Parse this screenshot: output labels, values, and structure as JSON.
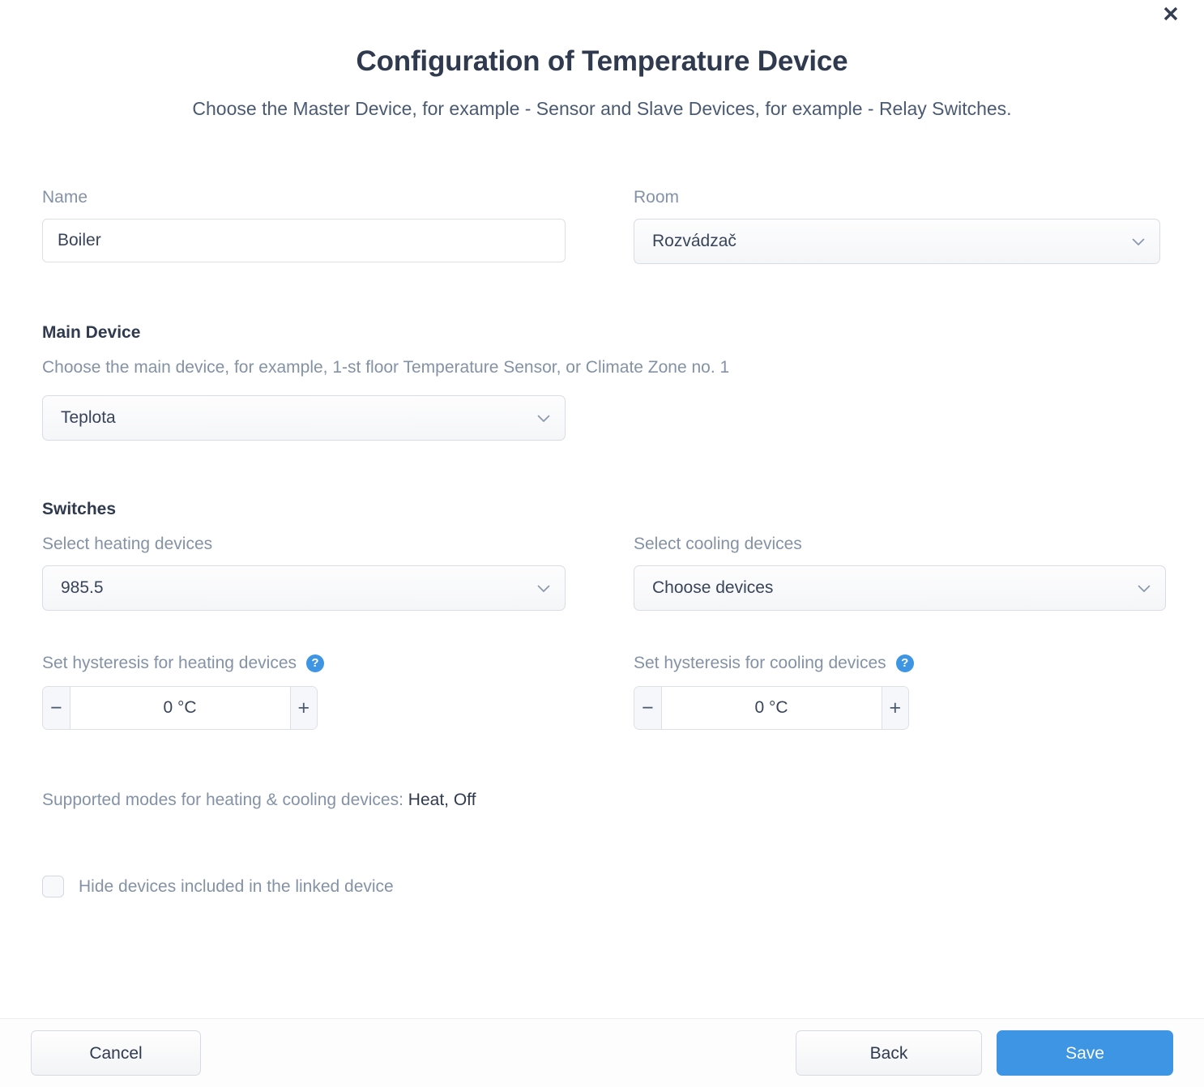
{
  "header": {
    "title": "Configuration of Temperature Device",
    "subtitle": "Choose the Master Device, for example - Sensor and Slave Devices, for example - Relay Switches.",
    "close_icon": "close-icon"
  },
  "form": {
    "name": {
      "label": "Name",
      "value": "Boiler",
      "placeholder": "Name"
    },
    "room": {
      "label": "Room",
      "value": "Rozvádzač",
      "chevron_icon": "chevron-down-icon"
    },
    "main_device": {
      "section_title": "Main Device",
      "description": "Choose the main device, for example, 1-st floor Temperature Sensor, or Climate Zone no. 1",
      "value": "Teplota",
      "chevron_icon": "chevron-down-icon"
    },
    "switches": {
      "section_title": "Switches",
      "heating": {
        "label": "Select heating devices",
        "value": "985.5",
        "chevron_icon": "chevron-down-icon"
      },
      "cooling": {
        "label": "Select cooling devices",
        "value": "Choose devices",
        "chevron_icon": "chevron-down-icon"
      },
      "heating_hysteresis": {
        "label": "Set hysteresis for heating devices",
        "help_icon": "?",
        "value": "0 °C",
        "minus_label": "−",
        "plus_label": "+"
      },
      "cooling_hysteresis": {
        "label": "Set hysteresis for cooling devices",
        "help_icon": "?",
        "value": "0 °C",
        "minus_label": "−",
        "plus_label": "+"
      }
    },
    "supported_modes": {
      "label": "Supported modes for heating & cooling devices:",
      "value": "Heat, Off"
    },
    "hide_devices": {
      "label": "Hide devices included in the linked device",
      "checked": false
    }
  },
  "footer": {
    "cancel_label": "Cancel",
    "back_label": "Back",
    "save_label": "Save"
  },
  "colors": {
    "accent": "#3e95e3",
    "title": "#2f3a4f",
    "label": "#8492a6",
    "border": "#dcdfe6"
  }
}
